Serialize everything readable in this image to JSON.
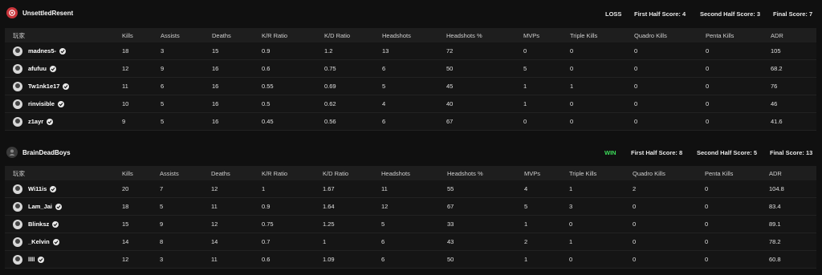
{
  "columns": [
    "玩家",
    "Kills",
    "Assists",
    "Deaths",
    "K/R Ratio",
    "K/D Ratio",
    "Headshots",
    "Headshots %",
    "MVPs",
    "Triple Kills",
    "Quadro Kills",
    "Penta Kills",
    "ADR"
  ],
  "teams": [
    {
      "name": "UnsettledResent",
      "result": "LOSS",
      "result_color": "#e8e8e8",
      "first_half": "First Half Score: 4",
      "second_half": "Second Half Score: 3",
      "final": "Final Score: 7",
      "players": [
        {
          "name": "madnes5-",
          "stats": [
            "18",
            "3",
            "15",
            "0.9",
            "1.2",
            "13",
            "72",
            "0",
            "0",
            "0",
            "0",
            "105"
          ]
        },
        {
          "name": "afufuu",
          "stats": [
            "12",
            "9",
            "16",
            "0.6",
            "0.75",
            "6",
            "50",
            "5",
            "0",
            "0",
            "0",
            "68.2"
          ]
        },
        {
          "name": "Tw1nk1e17",
          "stats": [
            "11",
            "6",
            "16",
            "0.55",
            "0.69",
            "5",
            "45",
            "1",
            "1",
            "0",
            "0",
            "76"
          ]
        },
        {
          "name": "rinvisible",
          "stats": [
            "10",
            "5",
            "16",
            "0.5",
            "0.62",
            "4",
            "40",
            "1",
            "0",
            "0",
            "0",
            "46"
          ]
        },
        {
          "name": "z1ayr",
          "stats": [
            "9",
            "5",
            "16",
            "0.45",
            "0.56",
            "6",
            "67",
            "0",
            "0",
            "0",
            "0",
            "41.6"
          ]
        }
      ]
    },
    {
      "name": "BrainDeadBoys",
      "result": "WIN",
      "result_color": "#3ddc5a",
      "first_half": "First Half Score: 8",
      "second_half": "Second Half Score: 5",
      "final": "Final Score: 13",
      "players": [
        {
          "name": "Wi11is",
          "stats": [
            "20",
            "7",
            "12",
            "1",
            "1.67",
            "11",
            "55",
            "4",
            "1",
            "2",
            "0",
            "104.8"
          ]
        },
        {
          "name": "Lam_Jai",
          "stats": [
            "18",
            "5",
            "11",
            "0.9",
            "1.64",
            "12",
            "67",
            "5",
            "3",
            "0",
            "0",
            "83.4"
          ]
        },
        {
          "name": "Blinksz",
          "stats": [
            "15",
            "9",
            "12",
            "0.75",
            "1.25",
            "5",
            "33",
            "1",
            "0",
            "0",
            "0",
            "89.1"
          ]
        },
        {
          "name": "_Kelvin",
          "stats": [
            "14",
            "8",
            "14",
            "0.7",
            "1",
            "6",
            "43",
            "2",
            "1",
            "0",
            "0",
            "78.2"
          ]
        },
        {
          "name": "llll",
          "stats": [
            "12",
            "3",
            "11",
            "0.6",
            "1.09",
            "6",
            "50",
            "1",
            "0",
            "0",
            "0",
            "60.8"
          ]
        }
      ]
    }
  ]
}
